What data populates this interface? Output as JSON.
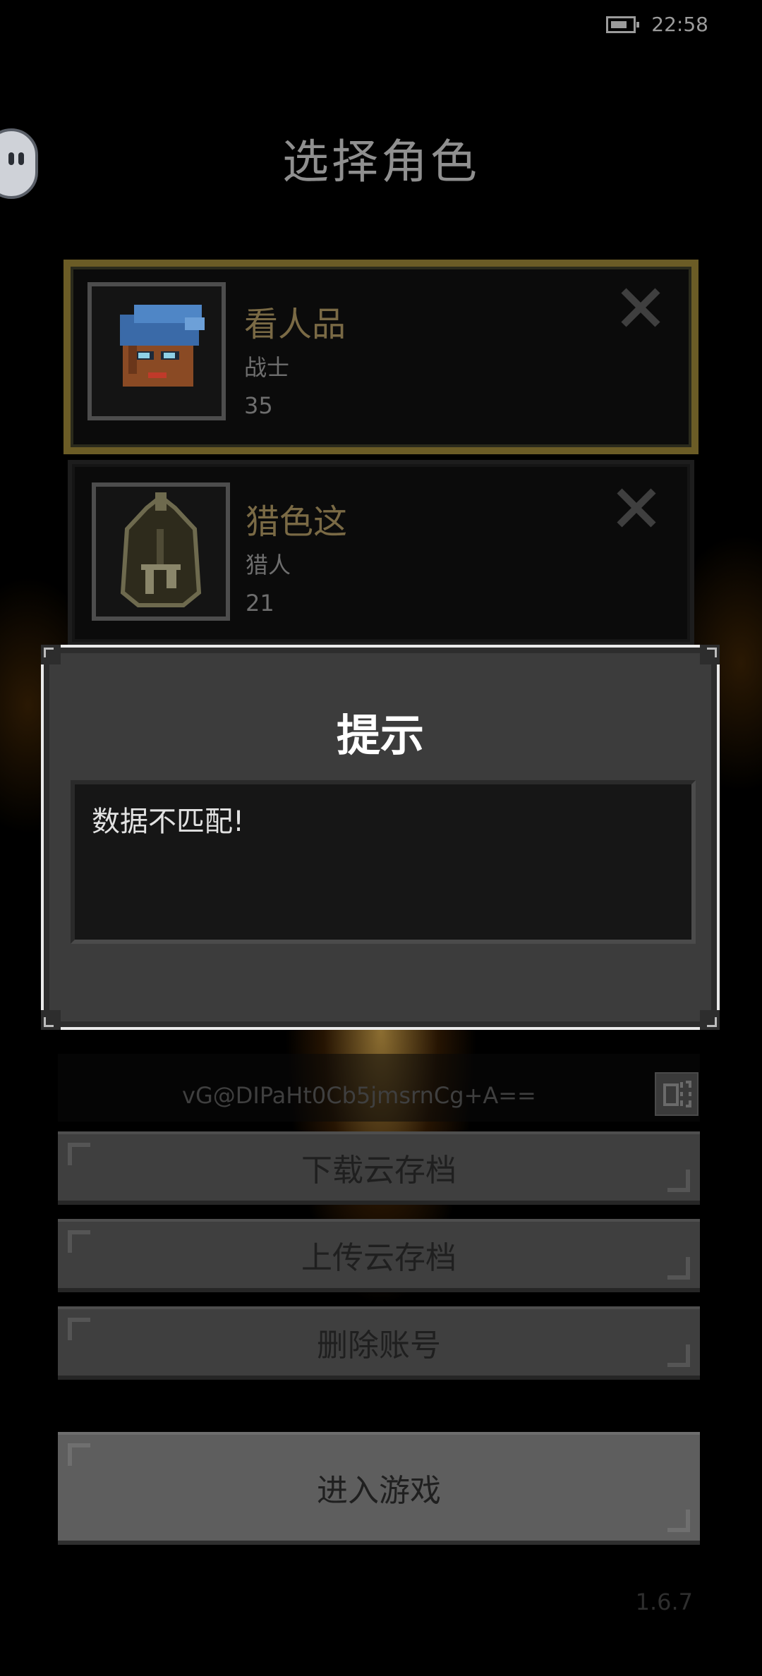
{
  "status_bar": {
    "time": "22:58",
    "battery_icon": "battery-icon",
    "battery_level": 0.6
  },
  "header": {
    "title": "选择角色"
  },
  "characters": [
    {
      "name": "看人品",
      "class": "战士",
      "level": "35",
      "selected": true,
      "portrait": "warrior-portrait-icon",
      "delete_icon": "close-icon"
    },
    {
      "name": "猎色这",
      "class": "猎人",
      "level": "21",
      "selected": false,
      "portrait": "hunter-helmet-portrait-icon",
      "delete_icon": "close-icon"
    }
  ],
  "account": {
    "code": "vG@DIPaHt0Cb5jmsrnCg+A==",
    "copy_icon": "copy-icon"
  },
  "buttons": {
    "download": "下载云存档",
    "upload": "上传云存档",
    "delete_account": "删除账号",
    "enter_game": "进入游戏"
  },
  "version": "1.6.7",
  "dialog": {
    "title": "提示",
    "message": "数据不匹配!"
  },
  "colors": {
    "selected_border": "#6b5c26",
    "name_text": "#7a6a45",
    "dialog_bg": "#3c3c3c"
  }
}
